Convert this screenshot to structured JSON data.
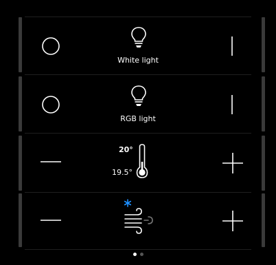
{
  "rows": [
    {
      "type": "switch",
      "label": "White light",
      "off_icon": "circle-off-icon",
      "on_icon": "line-on-icon",
      "icon": "bulb-icon"
    },
    {
      "type": "switch",
      "label": "RGB light",
      "off_icon": "circle-off-icon",
      "on_icon": "line-on-icon",
      "icon": "bulb-icon"
    },
    {
      "type": "thermostat",
      "setpoint": "20°",
      "current": "19.5°",
      "minus_icon": "minus-icon",
      "plus_icon": "plus-icon",
      "icon": "thermometer-icon"
    },
    {
      "type": "fan",
      "minus_icon": "minus-icon",
      "plus_icon": "plus-icon",
      "icon": "wind-icon",
      "mode_icon": "snowflake-icon"
    }
  ],
  "pagination": {
    "pages": 2,
    "active": 1
  },
  "colors": {
    "background": "#000000",
    "foreground": "#ffffff",
    "accent": "#1e90ff",
    "bar": "#3a3a3a"
  }
}
